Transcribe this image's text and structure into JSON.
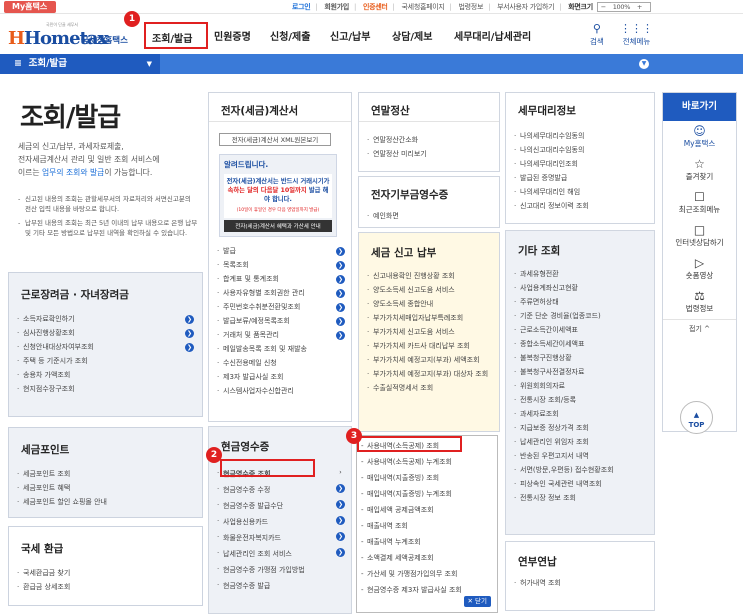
{
  "topbar": {
    "myhometax": "My홈택스",
    "links": [
      "로그인",
      "회원가입",
      "인증센터",
      "국세청홈페이지",
      "법령정보",
      "부서사용자 가입하기"
    ],
    "screen_label": "화면크기",
    "zoom": "100%"
  },
  "logo": {
    "small": "국민이 단골 세무서",
    "main": "Hometax",
    "sub": "국세청홈택스"
  },
  "gnb": [
    "조회/발급",
    "민원증명",
    "신청/제출",
    "신고/납부",
    "상담/제보",
    "세무대리/납세관리"
  ],
  "header_icons": {
    "search": "검색",
    "menu": "전체메뉴"
  },
  "badges": [
    "1",
    "2",
    "3"
  ],
  "nav": {
    "current": "조회/발급"
  },
  "page": {
    "title": "조회/발급",
    "intro_1": "세금의 신고/납부, 과세자료제출,",
    "intro_2": "전자세금계산서 관리 및 일반 조회 서비스에",
    "intro_3a": "이르는 ",
    "intro_3b": "업무의 조회와 발급",
    "intro_3c": "이 가능합니다.",
    "notes": [
      "신고된 내용의 조회는 관할세무서의 자료처리와 서면신고분의 전산 입력 내용을 바탕으로 합니다.",
      "납부된 내용의 조회는 최근 5년 이내의 납부 내용으로 은행 납부 및 기타 모든 방법으로 납부된 내역을 확인하실 수 있습니다."
    ]
  },
  "boxes": {
    "labor": {
      "title": "근로장려금 · 자녀장려금",
      "items": [
        "소득자료확인하기",
        "심사진행상황조회",
        "신청안내대상자여부조회",
        "주택 등 기준시가 조회",
        "송용차 가액조회",
        "현지점수장구조회"
      ]
    },
    "point": {
      "title": "세금포인트",
      "items": [
        "세금포인트 조회",
        "세금포인트 혜택",
        "세금포인트 할인 쇼핑몰 안내"
      ]
    },
    "refund": {
      "title": "국세 환급",
      "items": [
        "국세환급금 찾기",
        "환급금 상세조회"
      ]
    }
  },
  "einvoice": {
    "title": "전자(세금)계산서",
    "xml_btn": "전자(세금)계산서 XML원본보기",
    "alert_title": "알려드립니다.",
    "alert_body_1": "전자(세금)계산서는",
    "alert_body_2": "반드시 거래시기가",
    "alert_body_3": "속하는 달의 다음달 10일까지",
    "alert_body_4": "발급 해야 합니다.",
    "alert_small": "(10일이 휴일인 경우 다음 영업일까지 발급)",
    "alert_link": "전자(세금)계산서 혜택과 가산세 안내",
    "items": [
      "발급",
      "목록조회",
      "합계표 및 통계조회",
      "사용자유형별 조회권한 관리",
      "주민번호수취분전환및조회",
      "발급보류/예정목록조회",
      "거래처 및 품목관리",
      "메일발송목록 조회 및 재발송",
      "수신전용메일 신청",
      "제3자 발급사실 조회",
      "시스템사업자수신합관리"
    ]
  },
  "receipt": {
    "title": "현금영수증",
    "items": [
      "현금영수증 조회",
      "현금영수증 수정",
      "현금영수증 발급수단",
      "사업용신용카드",
      "화물운전자복지카드",
      "납세관리인 조회 서비스",
      "현금영수증 가맹점 가입방법",
      "현금영수증 발급"
    ],
    "submenu": [
      "사용내역(소득공제) 조회",
      "사용내역(소득공제) 누계조회",
      "매입내역(지출증빙) 조회",
      "매입내역(지출증빙) 누계조회",
      "매입세액 공제금액조회",
      "매출내역 조회",
      "매출내역 누계조회",
      "소액결제 세액공제조회",
      "가산세 및 가맹점가입의무 조회",
      "현금영수증 제3자 발급사실 조회"
    ],
    "close": "닫기"
  },
  "settlement": {
    "title": "연말정산",
    "items": [
      "연말정산간소화",
      "연말정산 미리보기"
    ]
  },
  "vat_card": {
    "title": "전자기부금영수증",
    "items": [
      "예인화면"
    ]
  },
  "tax_report": {
    "title": "세금 신고 납부",
    "items": [
      "신고내용확인 진행상황 조회",
      "양도소득세 신고도움 서비스",
      "양도소득세 종합안내",
      "부가가치세매입자납부특례조회",
      "부가가치세 신고도움 서비스",
      "부가가치세 카드사 대리납부 조회",
      "부가가치세 예정고지(부과) 세액조회",
      "부가가치세 예정고지(부과) 대상자 조회",
      "수출실적명세서 조회"
    ]
  },
  "agent": {
    "title": "세무대리정보",
    "items": [
      "나의세무대리수임동의",
      "나의신고대리수임동의",
      "나의세무대리인조회",
      "발급된 증명발급",
      "나의세무대리인 해임",
      "신고대리 정보이력 조회"
    ]
  },
  "other": {
    "title": "기타 조회",
    "items": [
      "과세유형전환",
      "사업용계좌신고현황",
      "주류면허상태",
      "기준 단순 경비율(업종코드)",
      "근로소득간이세액표",
      "종합소득세간이세액표",
      "불복청구진행상황",
      "불복청구사전결정자료",
      "위원회회의자료",
      "전통시장 조회/등록",
      "과세자료조회",
      "지급보증 정상가격 조회",
      "납세관리인 위임자 조회",
      "반송된 우편고지서 내역",
      "서면(방문,우편등) 접수현황조회",
      "피상속인 국세관련 내역조회",
      "전통시장 정보 조회"
    ]
  },
  "pension": {
    "title": "연부연납",
    "items": [
      "허가내역 조회"
    ]
  },
  "quick": {
    "title": "바로가기",
    "items": [
      "My홈택스",
      "즐겨찾기",
      "최근조회메뉴",
      "인터넷상담하기",
      "숏폼영상",
      "법령정보"
    ],
    "fold": "접기 ^",
    "top": "TOP"
  }
}
